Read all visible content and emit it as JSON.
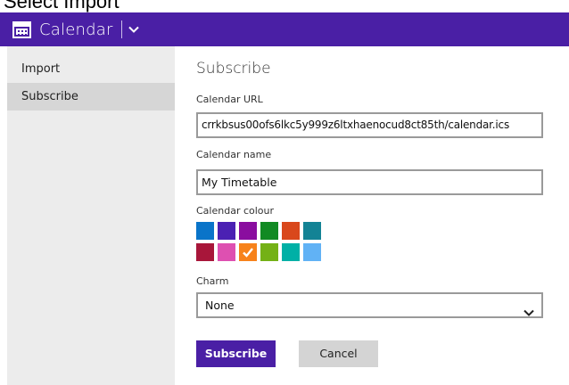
{
  "caption": "Select Import",
  "app": {
    "title": "Calendar"
  },
  "sidebar": {
    "items": [
      {
        "label": "Import",
        "active": false
      },
      {
        "label": "Subscribe",
        "active": true
      }
    ]
  },
  "form": {
    "heading": "Subscribe",
    "url_label": "Calendar URL",
    "url_value": "crrkbsus00ofs6lkc5y999z6ltxhaenocud8ct85th/calendar.ics",
    "name_label": "Calendar name",
    "name_value": "My Timetable",
    "colour_label": "Calendar colour",
    "colours_row1": [
      "#0a74c9",
      "#4b21b3",
      "#8a0d9f",
      "#118a23",
      "#d9481c",
      "#138395"
    ],
    "colours_row2": [
      "#a8163a",
      "#de50b1",
      "#f7821b",
      "#74b116",
      "#00b0a6",
      "#61b2f5"
    ],
    "selected_colour": "#f7821b",
    "charm_label": "Charm",
    "charm_value": "None",
    "subscribe_button": "Subscribe",
    "cancel_button": "Cancel"
  },
  "colors": {
    "accent": "#4a1fa5",
    "sidebar_bg": "#ececec",
    "sidebar_active": "#d6d6d6"
  }
}
